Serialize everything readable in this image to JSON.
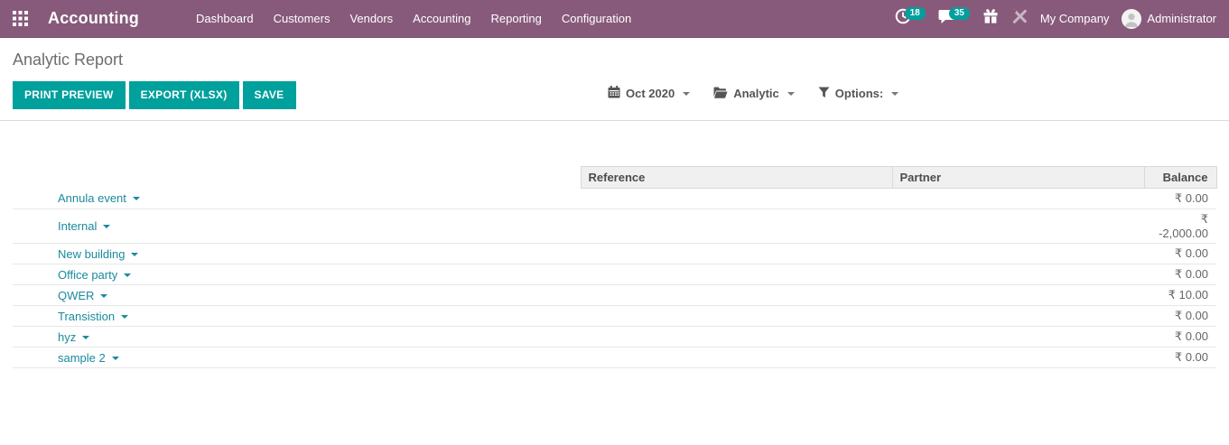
{
  "topbar": {
    "brand": "Accounting",
    "menu_items": [
      "Dashboard",
      "Customers",
      "Vendors",
      "Accounting",
      "Reporting",
      "Configuration"
    ],
    "systray": {
      "activity_count": "18",
      "message_count": "35",
      "company": "My Company",
      "user": "Administrator"
    }
  },
  "control_panel": {
    "title": "Analytic Report",
    "buttons": [
      "PRINT PREVIEW",
      "EXPORT (XLSX)",
      "SAVE"
    ],
    "filters": [
      {
        "icon": "calendar-icon",
        "label": "Oct 2020"
      },
      {
        "icon": "folder-open-icon",
        "label": "Analytic"
      },
      {
        "icon": "filter-icon",
        "label": "Options:"
      }
    ]
  },
  "table": {
    "headers": {
      "reference": "Reference",
      "partner": "Partner",
      "balance": "Balance"
    },
    "rows": [
      {
        "name": "Annula event",
        "reference": "",
        "partner": "",
        "balance": "₹ 0.00"
      },
      {
        "name": "Internal",
        "reference": "",
        "partner": "",
        "balance": "₹ -2,000.00"
      },
      {
        "name": "New building",
        "reference": "",
        "partner": "",
        "balance": "₹ 0.00"
      },
      {
        "name": "Office party",
        "reference": "",
        "partner": "",
        "balance": "₹ 0.00"
      },
      {
        "name": "QWER",
        "reference": "",
        "partner": "",
        "balance": "₹ 10.00"
      },
      {
        "name": "Transistion",
        "reference": "",
        "partner": "",
        "balance": "₹ 0.00"
      },
      {
        "name": "hyz",
        "reference": "",
        "partner": "",
        "balance": "₹ 0.00"
      },
      {
        "name": "sample 2",
        "reference": "",
        "partner": "",
        "balance": "₹ 0.00"
      }
    ]
  },
  "colors": {
    "topbar_purple": "#875A7B",
    "accent_teal": "#00A09D",
    "link_teal": "#1a8a9e"
  }
}
